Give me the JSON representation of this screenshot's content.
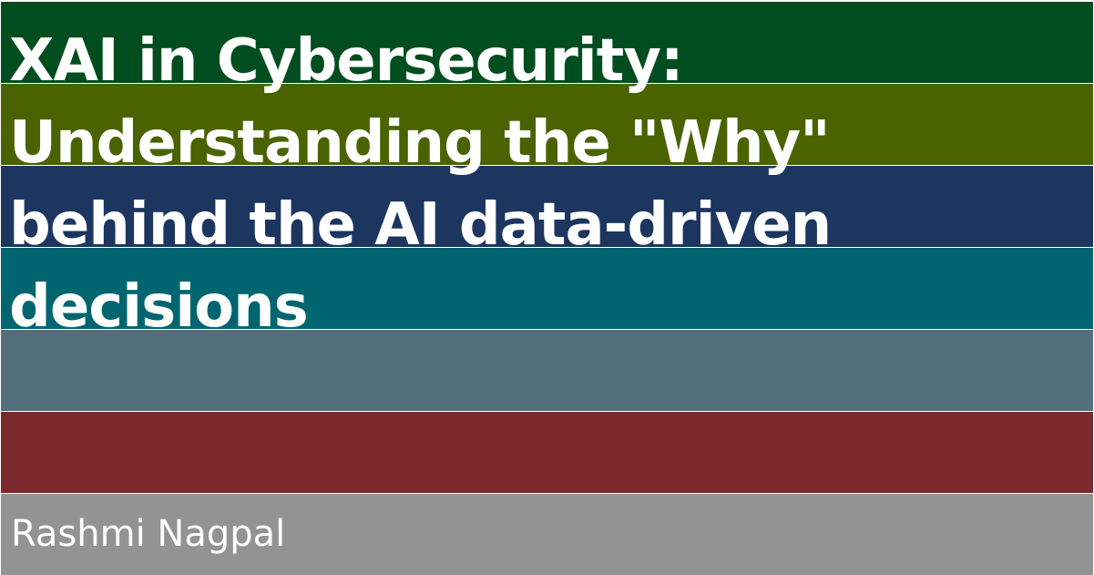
{
  "title_lines": [
    "XAI in Cybersecurity:",
    "Understanding the \"Why\"",
    "behind the AI data-driven",
    "decisions"
  ],
  "author": "Rashmi Nagpal",
  "band_colors": [
    "#004d1f",
    "#4a6300",
    "#1c3660",
    "#00656f",
    "#526f7a",
    "#7a2a2d",
    "#939393"
  ],
  "text_color": "#ffffff"
}
